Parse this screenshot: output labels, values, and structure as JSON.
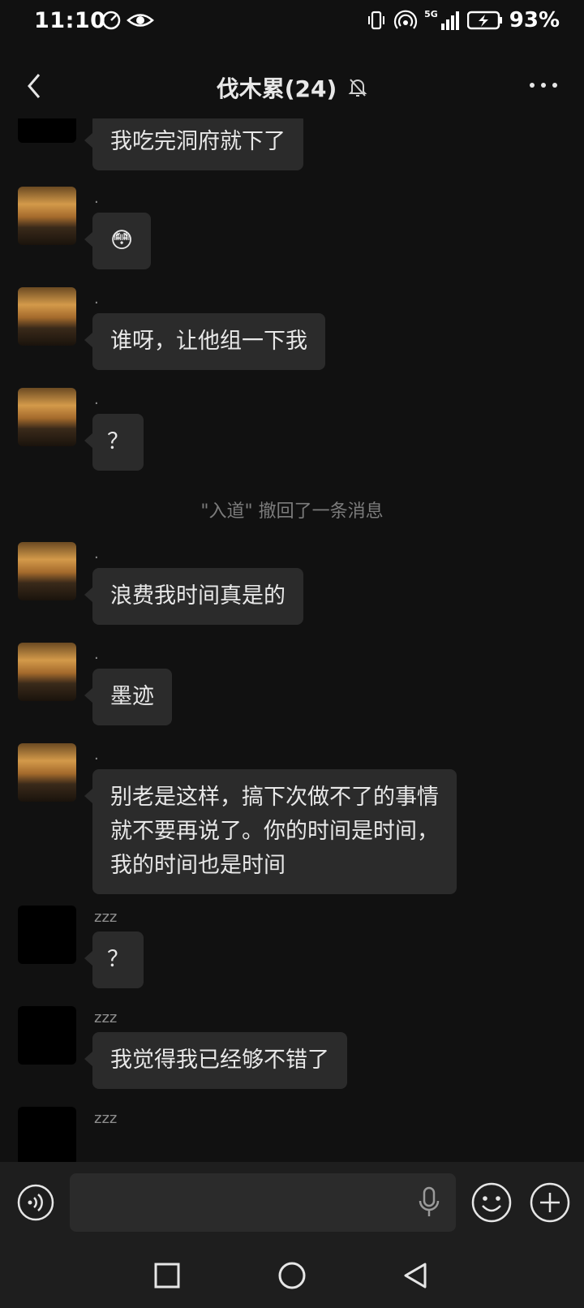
{
  "status_bar": {
    "time": "11:10",
    "battery": "93%",
    "network": "5G"
  },
  "header": {
    "title": "伐木累(24)",
    "back_icon": "chevron-left-icon",
    "mute_icon": "bell-off-icon",
    "more_icon": "more-dots-icon"
  },
  "messages": [
    {
      "nickname": "",
      "text": "我吃完洞府就下了",
      "avatar": "black"
    },
    {
      "nickname": ".",
      "text": "😳",
      "avatar": "landscape"
    },
    {
      "nickname": ".",
      "text": "谁呀，让他组一下我",
      "avatar": "landscape"
    },
    {
      "nickname": ".",
      "text": "？",
      "avatar": "landscape"
    },
    {
      "system": "\"入道\" 撤回了一条消息"
    },
    {
      "nickname": ".",
      "text": "浪费我时间真是的",
      "avatar": "landscape"
    },
    {
      "nickname": ".",
      "text": "墨迹",
      "avatar": "landscape"
    },
    {
      "nickname": ".",
      "lines": [
        "别老是这样，搞下次做不了的事情",
        "就不要再说了。你的时间是时间，",
        "我的时间也是时间"
      ],
      "avatar": "landscape"
    },
    {
      "nickname": "zzz",
      "text": "？",
      "avatar": "black"
    },
    {
      "nickname": "zzz",
      "text": "我觉得我已经够不错了",
      "avatar": "black"
    },
    {
      "nickname": "zzz",
      "text": "",
      "avatar": "black"
    }
  ],
  "input_bar": {
    "placeholder": "",
    "voice_icon": "voice-icon",
    "mic_icon": "microphone-icon",
    "emoji_icon": "emoji-icon",
    "plus_icon": "plus-circle-icon"
  },
  "nav_bar": {
    "recent_icon": "square-icon",
    "home_icon": "circle-icon",
    "back_icon": "triangle-back-icon"
  }
}
